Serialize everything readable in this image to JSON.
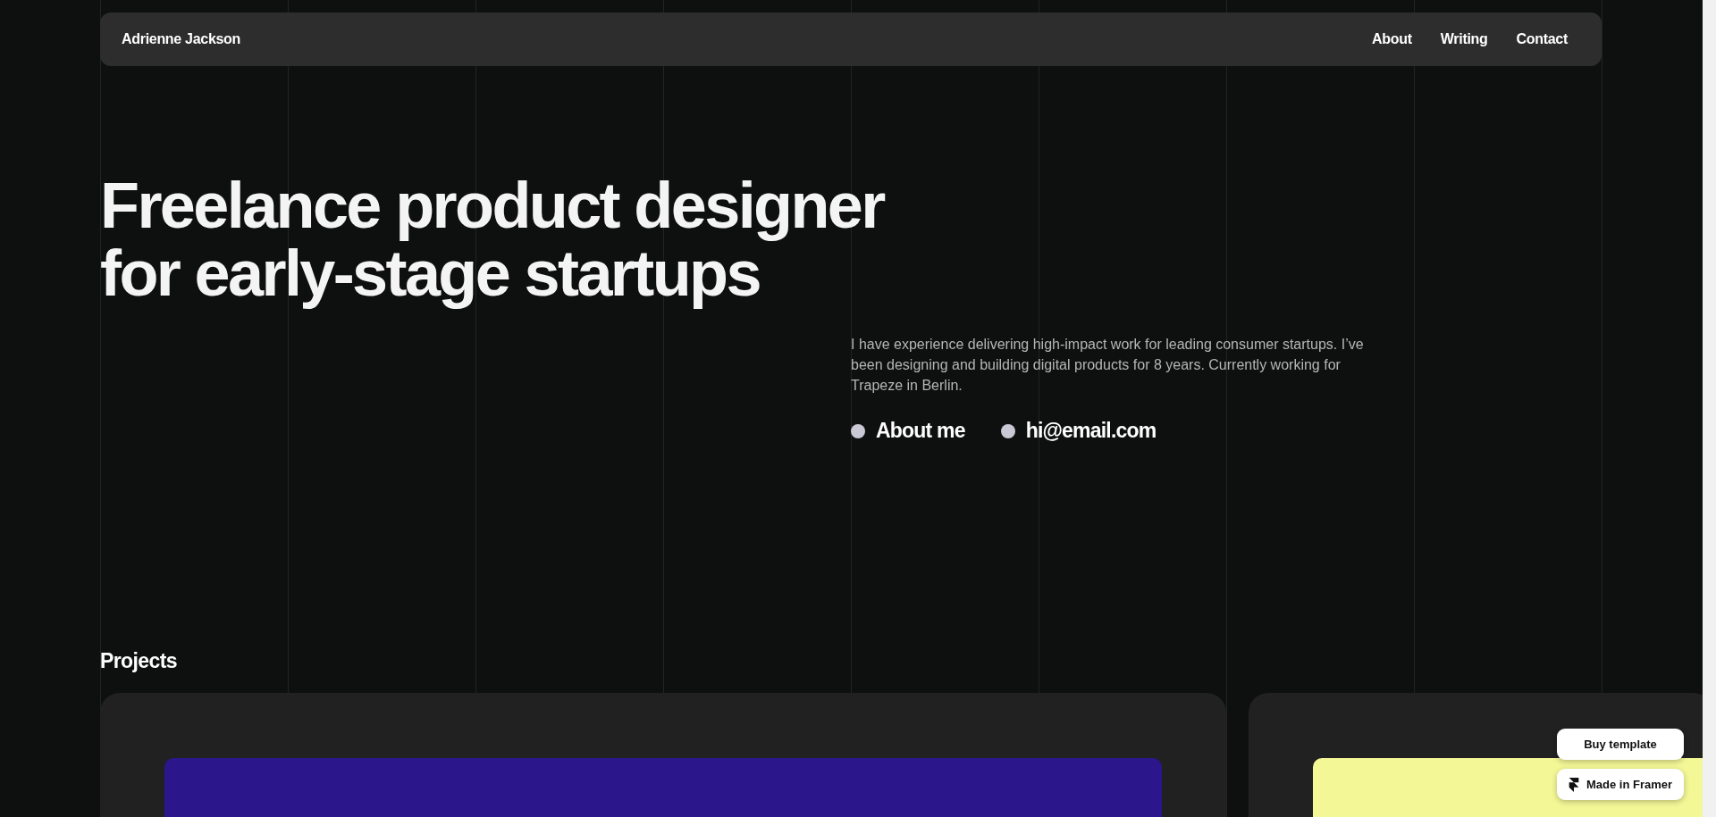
{
  "nav": {
    "brand": "Adrienne Jackson",
    "links": [
      {
        "label": "About"
      },
      {
        "label": "Writing"
      },
      {
        "label": "Contact"
      }
    ]
  },
  "hero": {
    "headline": "Freelance product designer for early-stage startups",
    "intro": "I have experience delivering high-impact work for leading consumer startups. I’ve been designing and building digital products for 8 years. Currently working for Trapeze in Berlin.",
    "links": [
      {
        "label": "About me"
      },
      {
        "label": "hi@email.com"
      }
    ]
  },
  "projects": {
    "heading": "Projects",
    "cards": [
      {
        "color": "#2b168c"
      },
      {
        "color": "#f3f796"
      }
    ]
  },
  "floating_buttons": [
    {
      "label": "Buy template",
      "kind": "plain"
    },
    {
      "label": "Made in Framer",
      "kind": "framer"
    }
  ]
}
